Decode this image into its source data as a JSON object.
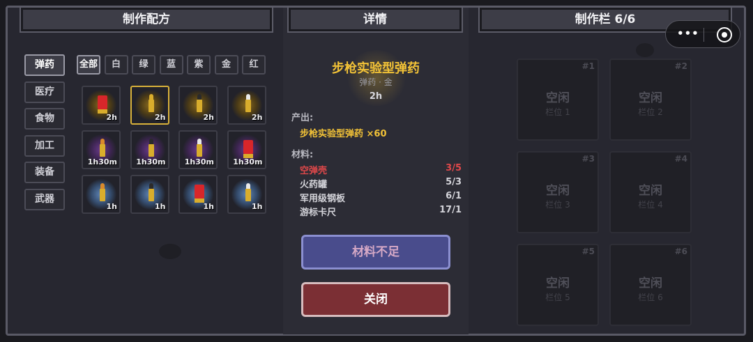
{
  "recipe_panel": {
    "title": "制作配方",
    "categories": [
      "弹药",
      "医疗",
      "食物",
      "加工",
      "装备",
      "武器"
    ],
    "active_category": "弹药",
    "filters": [
      "全部",
      "白",
      "绿",
      "蓝",
      "紫",
      "金",
      "红"
    ],
    "active_filter": "全部",
    "items": [
      {
        "time": "2h",
        "glow": "gold",
        "kind": "shell",
        "tip": "#d8262a"
      },
      {
        "time": "2h",
        "glow": "gold",
        "kind": "bullet",
        "tip": "#d9ad2c",
        "selected": true
      },
      {
        "time": "2h",
        "glow": "gold",
        "kind": "bullet",
        "tip": "#2b2b2b"
      },
      {
        "time": "2h",
        "glow": "gold",
        "kind": "bullet",
        "tip": "#e9e9e9"
      },
      {
        "time": "1h30m",
        "glow": "purple",
        "kind": "bullet",
        "tip": "#d98a2c"
      },
      {
        "time": "1h30m",
        "glow": "purple",
        "kind": "bullet",
        "tip": "#2b2b2b"
      },
      {
        "time": "1h30m",
        "glow": "purple",
        "kind": "bullet",
        "tip": "#e9e9e9"
      },
      {
        "time": "1h30m",
        "glow": "purple",
        "kind": "shell",
        "tip": "#d8262a"
      },
      {
        "time": "1h",
        "glow": "blue",
        "kind": "bullet",
        "tip": "#d98a2c"
      },
      {
        "time": "1h",
        "glow": "blue",
        "kind": "bullet",
        "tip": "#2b2b2b"
      },
      {
        "time": "1h",
        "glow": "blue",
        "kind": "shell",
        "tip": "#d8262a"
      },
      {
        "time": "1h",
        "glow": "blue",
        "kind": "bullet",
        "tip": "#e9e9e9"
      }
    ]
  },
  "detail_panel": {
    "title": "详情",
    "item_name": "步枪实验型弹药",
    "item_sub": "弹药 · 金",
    "item_time": "2h",
    "output_label": "产出:",
    "output_value": "步枪实验型弹药 ×60",
    "materials_label": "材料:",
    "materials": [
      {
        "name": "空弹壳",
        "qty": "3/5",
        "insufficient": true
      },
      {
        "name": "火药罐",
        "qty": "5/3",
        "insufficient": false
      },
      {
        "name": "军用级钢板",
        "qty": "6/1",
        "insufficient": false
      },
      {
        "name": "游标卡尺",
        "qty": "17/1",
        "insufficient": false
      }
    ],
    "lack_button": "材料不足",
    "close_button": "关闭"
  },
  "craft_panel": {
    "title": "制作栏 6/6",
    "slots": [
      {
        "num": "#1",
        "status": "空闲",
        "label": "栏位 1"
      },
      {
        "num": "#2",
        "status": "空闲",
        "label": "栏位 2"
      },
      {
        "num": "#3",
        "status": "空闲",
        "label": "栏位 3"
      },
      {
        "num": "#4",
        "status": "空闲",
        "label": "栏位 4"
      },
      {
        "num": "#5",
        "status": "空闲",
        "label": "栏位 5"
      },
      {
        "num": "#6",
        "status": "空闲",
        "label": "栏位 6"
      }
    ]
  },
  "capsule": {
    "more_icon": "more-dots-icon",
    "close_icon": "target-icon",
    "more_text": "•••"
  },
  "colors": {
    "gold": "#f2c237",
    "red": "#e0484a",
    "button_blue": "#494c8c",
    "button_red": "#7b2f34"
  }
}
